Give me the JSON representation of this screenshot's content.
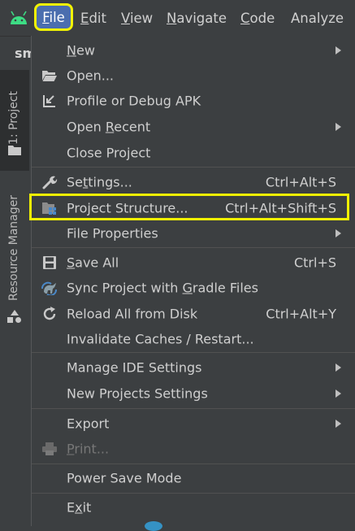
{
  "menubar": {
    "items": [
      {
        "label": "File",
        "mnemonic": "F",
        "rest": "ile"
      },
      {
        "label": "Edit",
        "mnemonic": "E",
        "rest": "dit"
      },
      {
        "label": "View",
        "mnemonic": "V",
        "rest": "iew"
      },
      {
        "label": "Navigate",
        "mnemonic": "N",
        "rest": "avigate"
      },
      {
        "label": "Code",
        "mnemonic": "C",
        "rest": "ode"
      },
      {
        "label": "Analyze",
        "mnemonic": "",
        "rest": "Analyze"
      }
    ]
  },
  "tabstrip": {
    "project_name": "sm"
  },
  "leftbar": {
    "project_tab": "1: Project",
    "resource_manager": "Resource Manager"
  },
  "menu": {
    "items": [
      {
        "pre": "",
        "mn": "N",
        "post": "ew",
        "shortcut": "",
        "submenu": true,
        "icon": ""
      },
      {
        "pre": "Open...",
        "mn": "",
        "post": "",
        "shortcut": "",
        "submenu": false,
        "icon": "folder-open-icon"
      },
      {
        "pre": "Profile or Debug APK",
        "mn": "",
        "post": "",
        "shortcut": "",
        "submenu": false,
        "icon": "import-arrow-icon"
      },
      {
        "pre": "Open ",
        "mn": "R",
        "post": "ecent",
        "shortcut": "",
        "submenu": true,
        "icon": ""
      },
      {
        "pre": "Close Project",
        "mn": "",
        "post": "",
        "shortcut": "",
        "submenu": false,
        "icon": ""
      },
      {
        "pre": "Se",
        "mn": "t",
        "post": "tings...",
        "shortcut": "Ctrl+Alt+S",
        "submenu": false,
        "icon": "wrench-icon"
      },
      {
        "pre": "Project Structure...",
        "mn": "",
        "post": "",
        "shortcut": "Ctrl+Alt+Shift+S",
        "submenu": false,
        "icon": "project-structure-icon"
      },
      {
        "pre": "File Properties",
        "mn": "",
        "post": "",
        "shortcut": "",
        "submenu": true,
        "icon": ""
      },
      {
        "pre": "",
        "mn": "S",
        "post": "ave All",
        "shortcut": "Ctrl+S",
        "submenu": false,
        "icon": "save-icon"
      },
      {
        "pre": "Sync Project with ",
        "mn": "G",
        "post": "radle Files",
        "shortcut": "",
        "submenu": false,
        "icon": "gradle-sync-icon"
      },
      {
        "pre": "Reload All from Disk",
        "mn": "",
        "post": "",
        "shortcut": "Ctrl+Alt+Y",
        "submenu": false,
        "icon": "reload-icon"
      },
      {
        "pre": "Invalidate Caches / Restart...",
        "mn": "",
        "post": "",
        "shortcut": "",
        "submenu": false,
        "icon": ""
      },
      {
        "pre": "Manage IDE Settings",
        "mn": "",
        "post": "",
        "shortcut": "",
        "submenu": true,
        "icon": ""
      },
      {
        "pre": "New Projects Settings",
        "mn": "",
        "post": "",
        "shortcut": "",
        "submenu": true,
        "icon": ""
      },
      {
        "pre": "Export",
        "mn": "",
        "post": "",
        "shortcut": "",
        "submenu": true,
        "icon": ""
      },
      {
        "pre": "",
        "mn": "P",
        "post": "rint...",
        "shortcut": "",
        "submenu": false,
        "icon": "print-icon",
        "disabled": true
      },
      {
        "pre": "Power Save Mode",
        "mn": "",
        "post": "",
        "shortcut": "",
        "submenu": false,
        "icon": ""
      },
      {
        "pre": "E",
        "mn": "x",
        "post": "it",
        "shortcut": "",
        "submenu": false,
        "icon": ""
      }
    ]
  },
  "colors": {
    "background": "#3c3f41",
    "selected_menu": "#4b6eaf",
    "highlight_outline": "#f2f200",
    "text": "#cfcfcf",
    "disabled_text": "#777777"
  }
}
